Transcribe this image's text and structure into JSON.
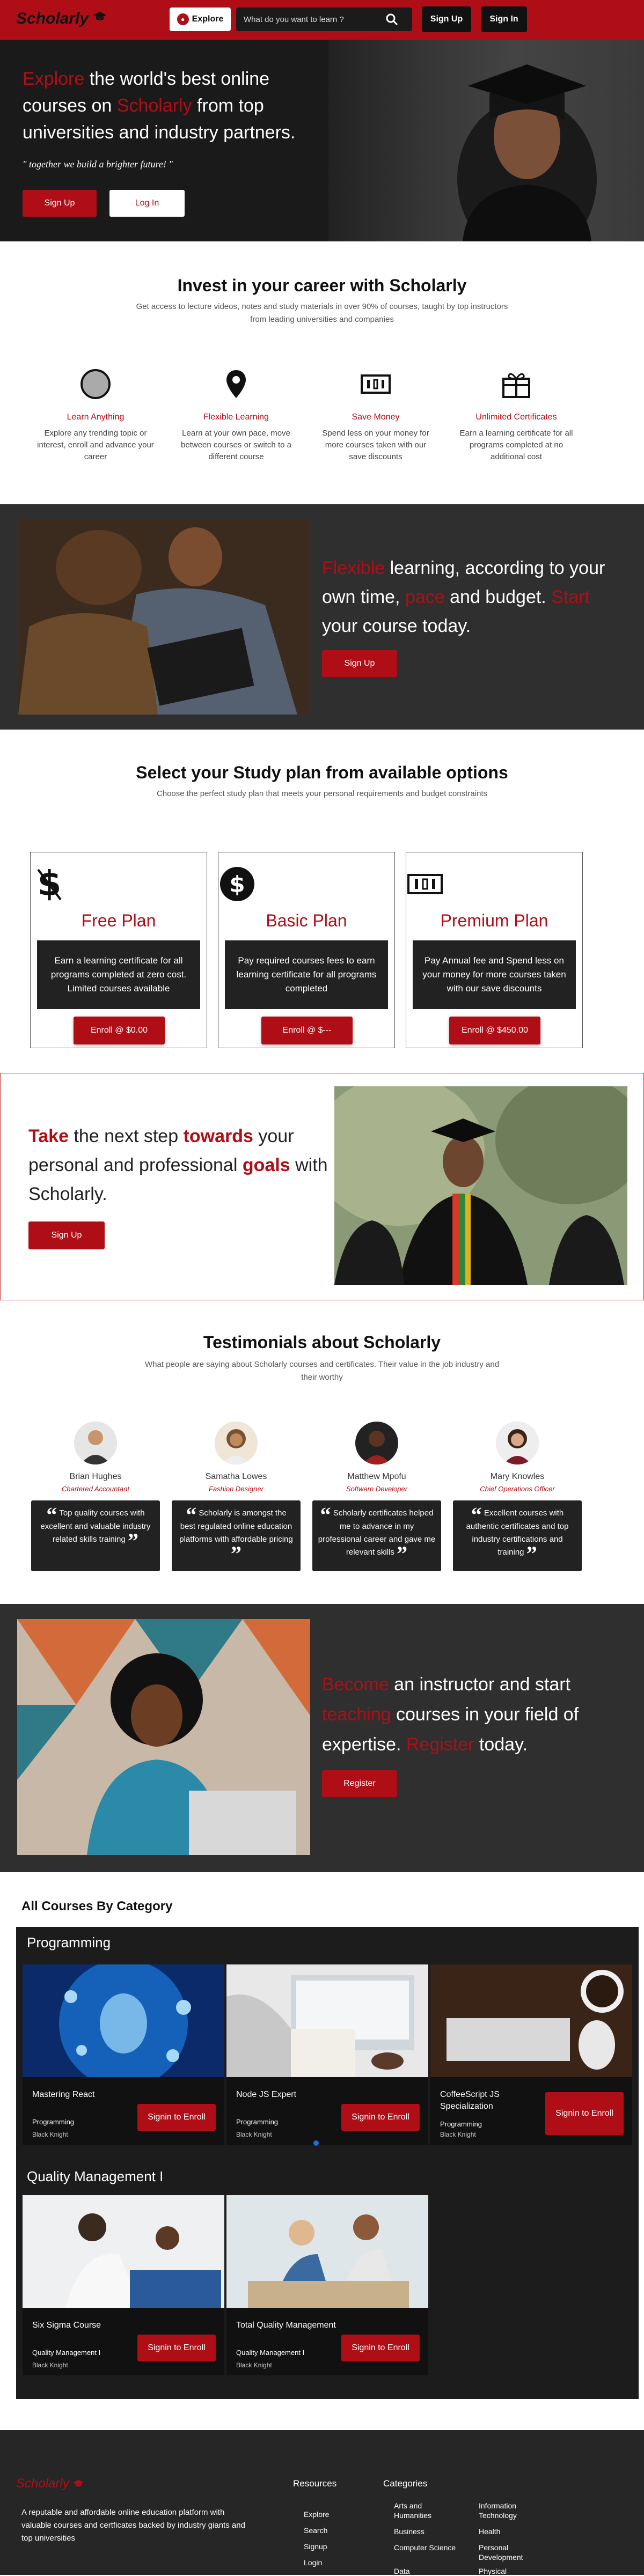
{
  "nav": {
    "logo": "Scholarly",
    "explore_label": "Explore",
    "search_placeholder": "What do you want to learn ?",
    "signup_label": "Sign Up",
    "signin_label": "Sign In"
  },
  "hero": {
    "word1": "Explore",
    "text1": " the world's best online courses on ",
    "word2": "Scholarly",
    "text2": " from top universities and industry partners.",
    "quote": "\" together we build a brighter future! \"",
    "signup_label": "Sign Up",
    "login_label": "Log In"
  },
  "invest": {
    "title": "Invest in your career with Scholarly",
    "subtitle": "Get access to lecture videos, notes and study materials in over 90% of courses, taught by top instructors from leading universities and companies",
    "features": [
      {
        "icon": "circle-icon",
        "title": "Learn Anything",
        "desc": "Explore any trending topic or interest, enroll and advance your career"
      },
      {
        "icon": "location-pin-icon",
        "title": "Flexible Learning",
        "desc": "Learn at your own pace, move between courses or switch to a different course"
      },
      {
        "icon": "money-bill-icon",
        "title": "Save Money",
        "desc": "Spend less on your money for more courses taken with our save discounts"
      },
      {
        "icon": "gift-certificate-icon",
        "title": "Unlimited Certificates",
        "desc": "Earn a learning certificate for all programs completed at no additional cost"
      }
    ]
  },
  "flexible": {
    "w1": "Flexible",
    "t1": " learning, according to your own time, ",
    "w2": "pace",
    "t2": " and budget. ",
    "w3": "Start",
    "t3": " your course today.",
    "signup_label": "Sign Up"
  },
  "plans": {
    "title": "Select your Study plan from available options",
    "subtitle": "Choose the perfect study plan that meets your personal requirements and budget constraints",
    "items": [
      {
        "icon": "dollar-icon",
        "name": "Free Plan",
        "desc": "Earn a learning certificate for all programs completed at zero cost. Limited courses available",
        "button": "Enroll @ $0.00"
      },
      {
        "icon": "dollar-circle-icon",
        "name": "Basic Plan",
        "desc": "Pay required courses fees to earn learning certificate for all programs completed",
        "button": "Enroll @ $---"
      },
      {
        "icon": "money-bill-icon",
        "name": "Premium Plan",
        "desc": "Pay Annual fee and Spend less on your money for more courses taken with our save discounts",
        "button": "Enroll @ $450.00"
      }
    ]
  },
  "take": {
    "w1": "Take",
    "t1": " the next step ",
    "w2": "towards",
    "t2": " your personal and professional ",
    "w3": "goals",
    "t3": " with Scholarly.",
    "signup_label": "Sign Up"
  },
  "testimonials": {
    "title": "Testimonials about Scholarly",
    "subtitle": "What people are saying about Scholarly courses and certificates. Their value in the job industry and their worthy",
    "items": [
      {
        "name": "Brian Hughes",
        "role": "Chartered Accountant",
        "quote": "Top quality courses with excellent and valuable industry related skills training"
      },
      {
        "name": "Samatha Lowes",
        "role": "Fashion Designer",
        "quote": "Scholarly is amongst the best regulated online education platforms with affordable pricing"
      },
      {
        "name": "Matthew Mpofu",
        "role": "Software Developer",
        "quote": "Scholarly certificates helped me to advance in my professional career and gave me relevant skills"
      },
      {
        "name": "Mary Knowles",
        "role": "Chief Operations Officer",
        "quote": "Excellent courses with authentic certificates and top industry certifications and training"
      }
    ]
  },
  "instructor": {
    "w1": "Become",
    "t1": " an instructor and start ",
    "w2": "teaching",
    "t2": " courses in your field of expertise. ",
    "w3": "Register",
    "t3": " today.",
    "register_label": "Register"
  },
  "courses": {
    "title": "All Courses By Category",
    "categories": [
      {
        "name": "Programming",
        "items": [
          {
            "title": "Mastering React",
            "category": "Programming",
            "author": "Black Knight",
            "button": "Signin to Enroll"
          },
          {
            "title": "Node JS Expert",
            "category": "Programming",
            "author": "Black Knight",
            "button": "Signin to Enroll"
          },
          {
            "title": "CoffeeScript JS Specialization",
            "category": "Programming",
            "author": "Black Knight",
            "button": "Signin to Enroll"
          }
        ]
      },
      {
        "name": "Quality Management I",
        "items": [
          {
            "title": "Six Sigma Course",
            "category": "Quality Management I",
            "author": "Black Knight",
            "button": "Signin to Enroll"
          },
          {
            "title": "Total Quality Management",
            "category": "Quality Management I",
            "author": "Black Knight",
            "button": "Signin to Enroll"
          }
        ]
      }
    ]
  },
  "footer": {
    "logo": "Scholarly",
    "desc": "A reputable and affordable online education platform with valuable courses and certficates backed by industry giants and top universities",
    "resources_title": "Resources",
    "resources": [
      "Explore",
      "Search",
      "Signup",
      "Login"
    ],
    "categories_title": "Categories",
    "categories_col1": [
      "Arts and Humanities",
      "Business",
      "Computer Science",
      "Data"
    ],
    "categories_col2": [
      "Information Technology",
      "Health",
      "Personal Development",
      "Physical"
    ]
  },
  "colors": {
    "accent": "#b00e16",
    "dark": "#2f2f2f",
    "darker": "#1c1c1c"
  }
}
